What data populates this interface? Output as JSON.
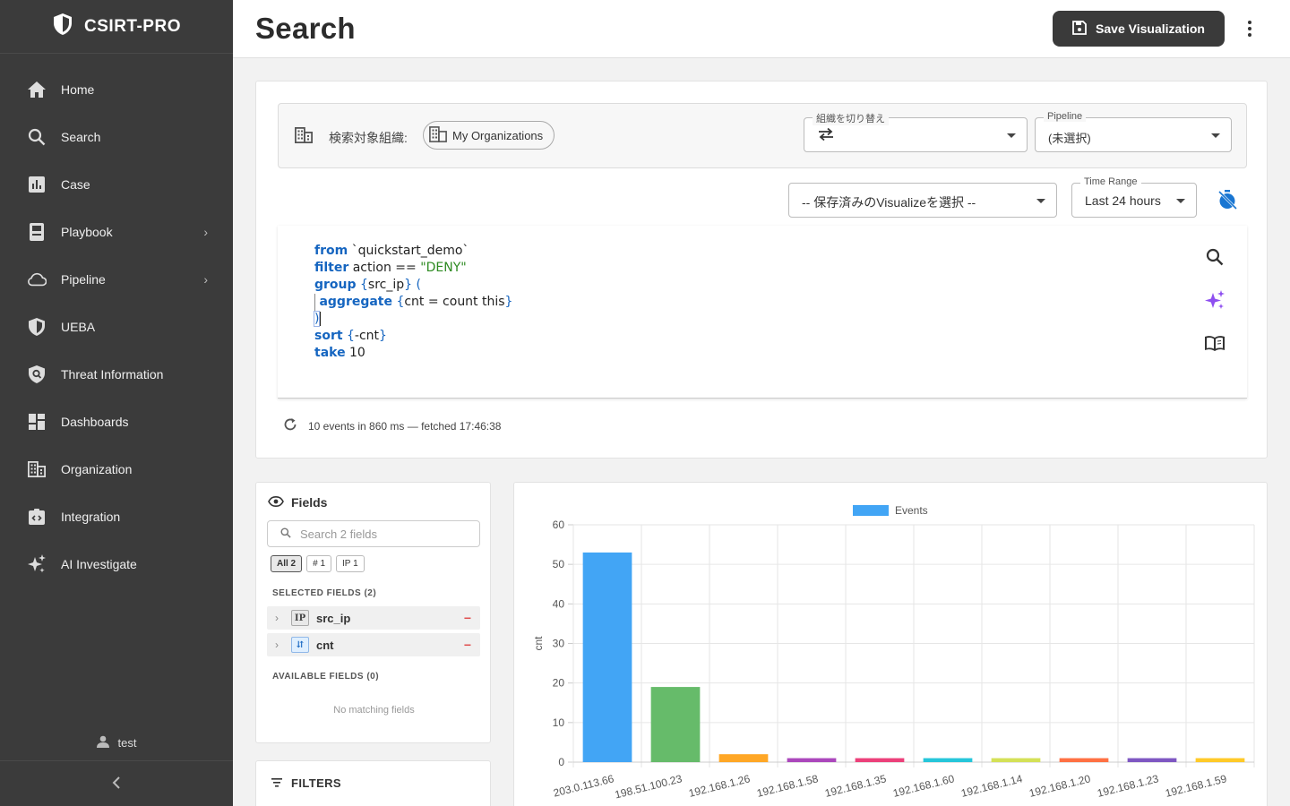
{
  "app": {
    "brand": "CSIRT-PRO",
    "user": "test"
  },
  "sidebar": {
    "items": [
      {
        "label": "Home",
        "icon": "home-icon"
      },
      {
        "label": "Search",
        "icon": "search-icon"
      },
      {
        "label": "Case",
        "icon": "bar-chart-icon"
      },
      {
        "label": "Playbook",
        "icon": "book-icon",
        "chevron": "›"
      },
      {
        "label": "Pipeline",
        "icon": "cloud-icon",
        "chevron": "›"
      },
      {
        "label": "UEBA",
        "icon": "shield-icon"
      },
      {
        "label": "Threat Information",
        "icon": "shield-search-icon"
      },
      {
        "label": "Dashboards",
        "icon": "dashboard-icon"
      },
      {
        "label": "Organization",
        "icon": "building-icon"
      },
      {
        "label": "Integration",
        "icon": "integration-icon"
      },
      {
        "label": "AI Investigate",
        "icon": "sparkle-icon"
      }
    ]
  },
  "header": {
    "title": "Search",
    "save_label": "Save Visualization"
  },
  "search": {
    "org_label": "検索対象組織:",
    "org_chip": "My Organizations",
    "switch_legend": "組織を切り替え",
    "pipeline_legend": "Pipeline",
    "pipeline_value": "(未選択)",
    "visualize_value": "-- 保存済みのVisualizeを選択 --",
    "time_legend": "Time Range",
    "time_value": "Last 24 hours",
    "status": "10 events in 860 ms — fetched 17:46:38",
    "query": {
      "l1_kw": "from",
      "l1_rest": " `quickstart_demo`",
      "l2_kw": "filter",
      "l2_rest": " action == ",
      "l2_str": "\"DENY\"",
      "l3_kw": "group",
      "l3_a": " {",
      "l3_b": "src_ip",
      "l3_c": "} (",
      "l4_kw": "aggregate",
      "l4_a": " {",
      "l4_b": "cnt = count this",
      "l4_c": "}",
      "l5": ")",
      "l6_kw": "sort",
      "l6_a": " {",
      "l6_b": "-cnt",
      "l6_c": "}",
      "l7_kw": "take",
      "l7_rest": " 10"
    }
  },
  "fields": {
    "title": "Fields",
    "search_placeholder": "Search 2 fields",
    "chips": [
      "All 2",
      "# 1",
      "IP 1"
    ],
    "selected_label": "SELECTED FIELDS (2)",
    "selected": [
      {
        "type": "IP",
        "name": "src_ip"
      },
      {
        "type": "⇵",
        "name": "cnt"
      }
    ],
    "available_label": "AVAILABLE FIELDS (0)",
    "no_match": "No matching fields",
    "filters_title": "FILTERS"
  },
  "chart_data": {
    "type": "bar",
    "categories": [
      "203.0.113.66",
      "198.51.100.23",
      "192.168.1.26",
      "192.168.1.58",
      "192.168.1.35",
      "192.168.1.60",
      "192.168.1.14",
      "192.168.1.20",
      "192.168.1.23",
      "192.168.1.59"
    ],
    "series": [
      {
        "name": "Events",
        "values": [
          53,
          19,
          2,
          1,
          1,
          1,
          1,
          1,
          1,
          1
        ]
      }
    ],
    "colors": [
      "#42a5f5",
      "#66bb6a",
      "#ffa726",
      "#ab47bc",
      "#ec407a",
      "#26c6da",
      "#d4e157",
      "#ff7043",
      "#7e57c2",
      "#ffca28"
    ],
    "title": "",
    "xlabel": "",
    "ylabel": "cnt",
    "ylim": [
      0,
      60
    ],
    "yticks": [
      0,
      10,
      20,
      30,
      40,
      50,
      60
    ],
    "legend": "top",
    "grid": true
  }
}
